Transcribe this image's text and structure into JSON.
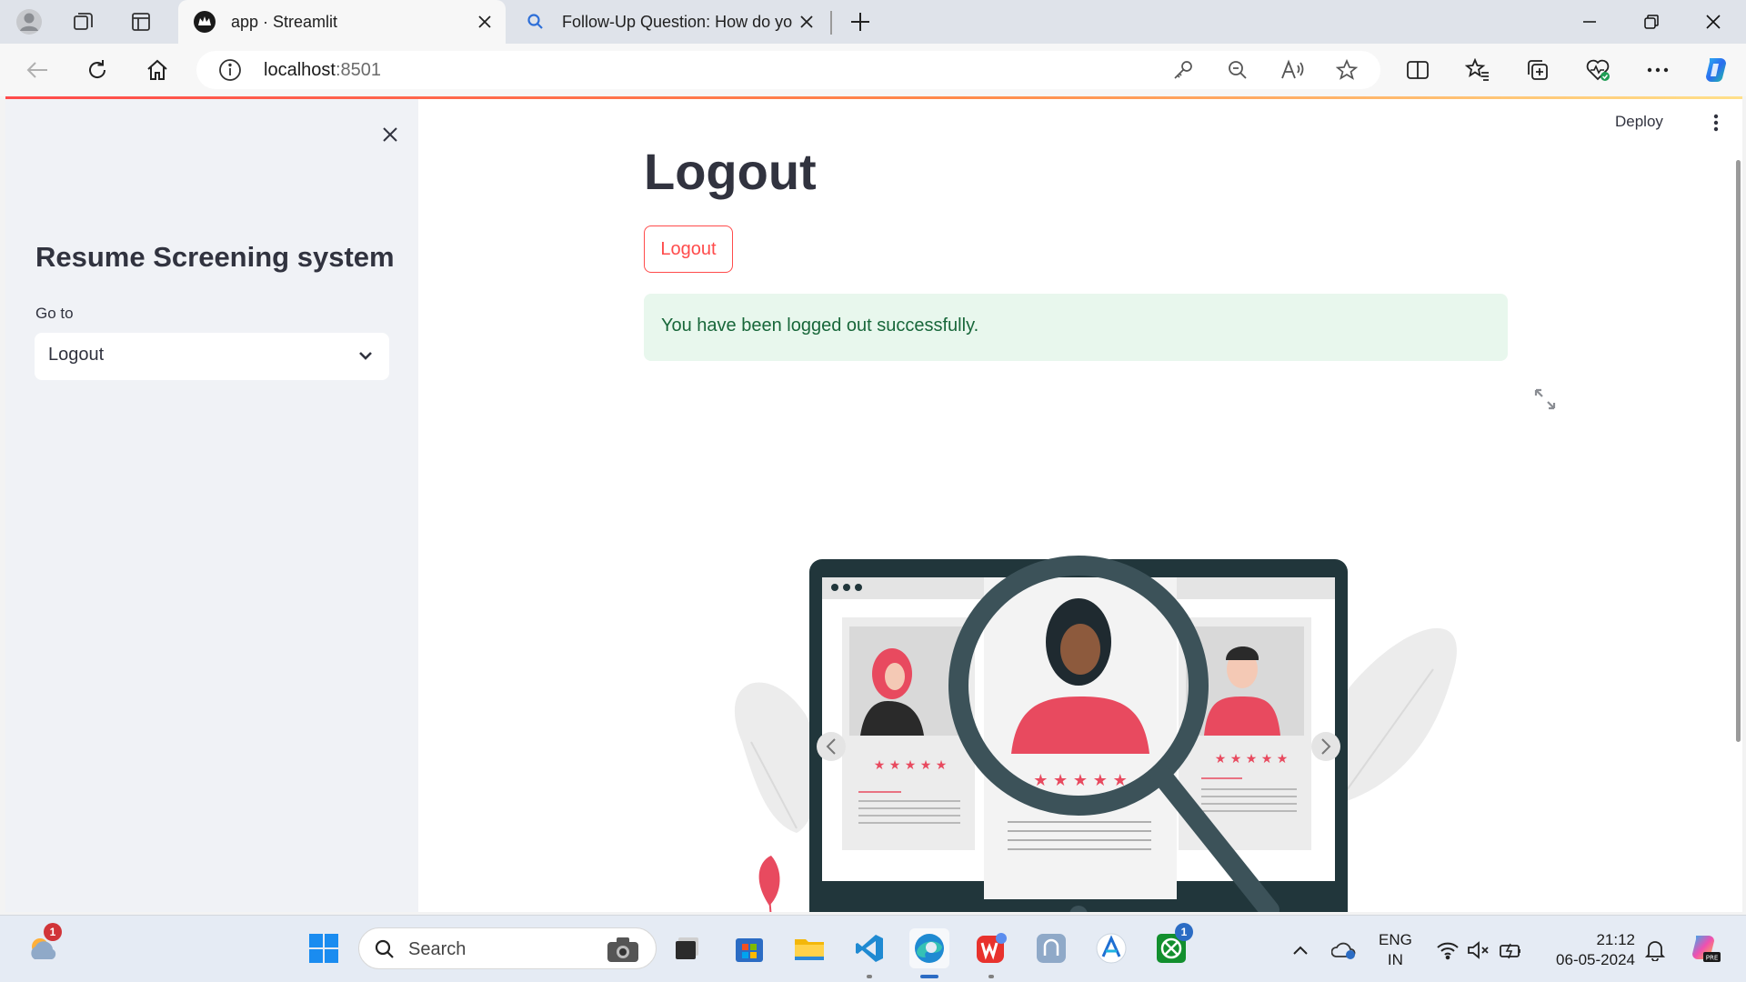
{
  "browser": {
    "tabs": [
      {
        "title": "app · Streamlit",
        "active": true
      },
      {
        "title": "Follow-Up Question: How do you",
        "active": false
      }
    ],
    "address": {
      "host": "localhost",
      "port": ":8501"
    }
  },
  "sidebar": {
    "title": "Resume Screening system",
    "goto_label": "Go to",
    "selected_page": "Logout"
  },
  "main": {
    "deploy_label": "Deploy",
    "heading": "Logout",
    "logout_button": "Logout",
    "success_message": "You have been logged out successfully."
  },
  "taskbar": {
    "search_placeholder": "Search",
    "weather_badge": "1",
    "xbox_badge": "1",
    "language": "ENG",
    "region": "IN",
    "time": "21:12",
    "date": "06-05-2024"
  },
  "colors": {
    "accent": "#ff4b4b",
    "success_bg": "#e8f7ed",
    "success_text": "#18673a",
    "sidebar_bg": "#f0f2f6",
    "text": "#31333f"
  }
}
